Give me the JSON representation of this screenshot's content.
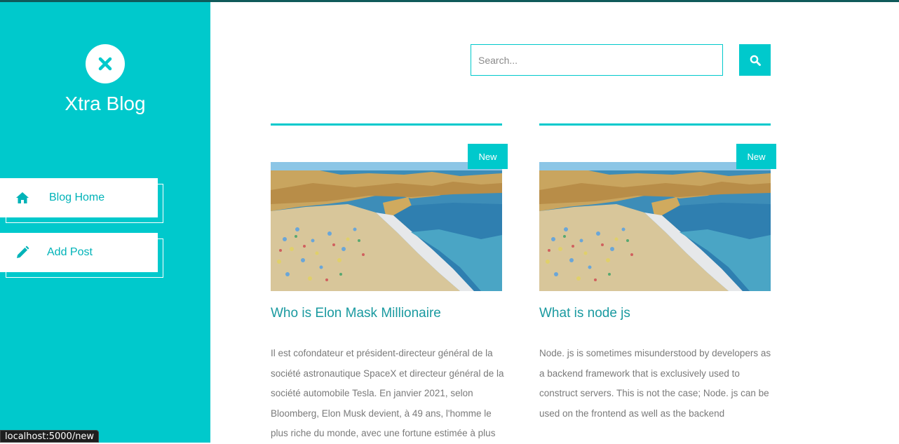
{
  "brand": {
    "name": "Xtra Blog",
    "logo_icon": "close-x-icon"
  },
  "sidebar": {
    "items": [
      {
        "label": "Blog Home",
        "icon": "home-icon"
      },
      {
        "label": "Add Post",
        "icon": "pencil-icon"
      }
    ]
  },
  "search": {
    "placeholder": "Search...",
    "value": "",
    "button_icon": "search-icon"
  },
  "posts": [
    {
      "badge": "New",
      "title": "Who is Elon Mask Millionaire",
      "excerpt": "Il est cofondateur et président-directeur général de la société astronautique SpaceX et directeur général de la société automobile Tesla. En janvier 2021, selon Bloomberg, Elon Musk devient, à 49 ans, l'homme le plus riche du monde, avec une fortune estimée à plus"
    },
    {
      "badge": "New",
      "title": "What is node js",
      "excerpt": "Node. js is sometimes misunderstood by developers as a backend framework that is exclusively used to construct servers. This is not the case; Node. js can be used on the frontend as well as the backend"
    }
  ],
  "status_url": "localhost:5000/new",
  "colors": {
    "accent": "#00c9cc",
    "title": "#1a9aa0",
    "text": "#7a7a7a",
    "topline": "#0f5a5a"
  }
}
